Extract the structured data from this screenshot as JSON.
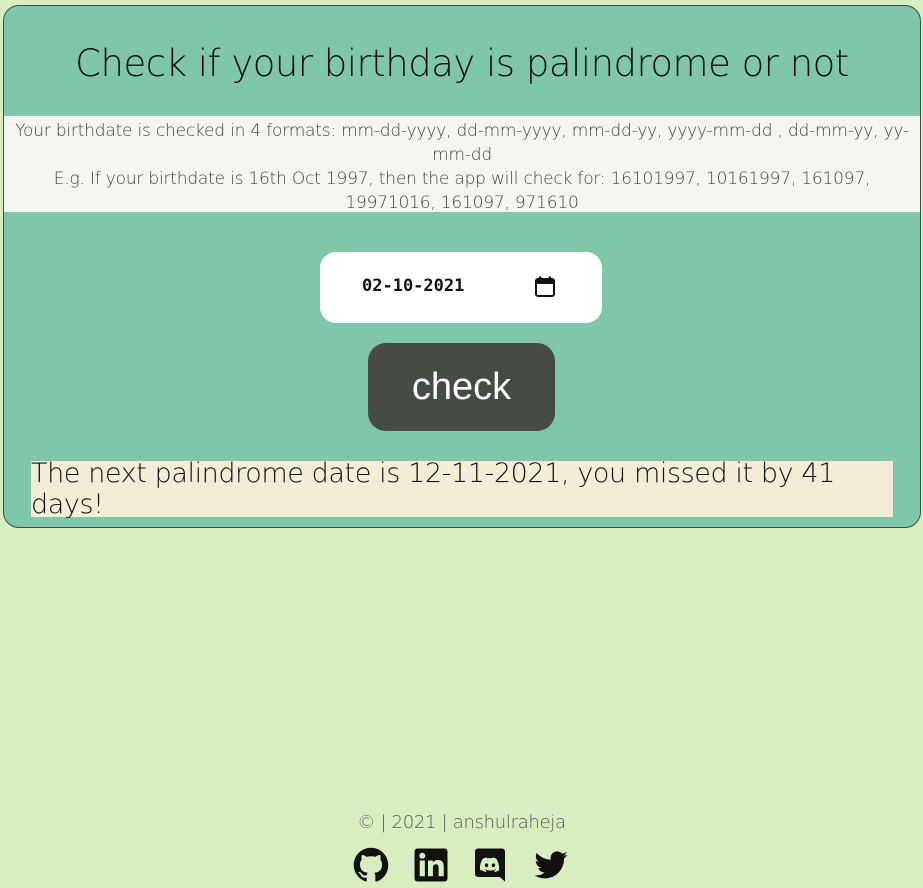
{
  "header": {
    "title": "Check if your birthday is palindrome or not"
  },
  "info": {
    "line1": "Your birthdate is checked in 4 formats: mm-dd-yyyy, dd-mm-yyyy, mm-dd-yy, yyyy-mm-dd , dd-mm-yy, yy-mm-dd",
    "line2": "E.g. If your birthdate is 16th Oct 1997, then the app will check for: 16101997, 10161997, 161097, 19971016, 161097, 971610"
  },
  "date_input": {
    "value": "02-10-2021",
    "icon": "calendar-icon"
  },
  "check_button": {
    "label": "check"
  },
  "result": {
    "message": "The next palindrome date is 12-11-2021, you missed it by 41 days!"
  },
  "footer": {
    "text": "© | 2021 | anshulraheja",
    "links": [
      {
        "name": "github",
        "icon": "github-icon"
      },
      {
        "name": "linkedin",
        "icon": "linkedin-icon"
      },
      {
        "name": "discord",
        "icon": "discord-icon"
      },
      {
        "name": "twitter",
        "icon": "twitter-icon"
      }
    ]
  },
  "colors": {
    "background": "#d8eec0",
    "card": "#80c7a9",
    "button": "#464b45",
    "result_bg": "#f3edd7",
    "info_bg": "#f5f5f0"
  }
}
